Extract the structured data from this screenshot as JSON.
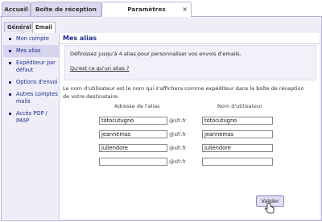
{
  "tabs": [
    {
      "label": "Accueil"
    },
    {
      "label": "Boîte de réception"
    },
    {
      "label": "Paramètres",
      "close": "×"
    }
  ],
  "subtabs": [
    {
      "label": "Général"
    },
    {
      "label": "Email"
    }
  ],
  "sidebar": {
    "items": [
      {
        "label": "Mon compte"
      },
      {
        "label": "Mes alias"
      },
      {
        "label": "Expéditeur par défaut"
      },
      {
        "label": "Options d'envoi"
      },
      {
        "label": "Autres comptes mails"
      },
      {
        "label": "Accès POP / IMAP"
      }
    ]
  },
  "main": {
    "heading": "Mes alias",
    "info_text": "Définissez jusqu'à 4 alias pour personnaliser vos envois d'emails.",
    "info_link": "Qu'est ce qu'un alias ?",
    "description": "Le nom d'utilisateur est le nom qui s'affichera comme expéditeur dans la boîte de réception de votre destinataire.",
    "col_alias": "Adresse de l'alias",
    "col_user": "Nom d'utilisateur",
    "domain": "@sfr.fr",
    "rows": [
      {
        "alias": "totocutugno",
        "user": "totocutugno"
      },
      {
        "alias": "jeannemas",
        "user": "jeannemas"
      },
      {
        "alias": "juliendore",
        "user": "juliendore"
      },
      {
        "alias": "",
        "user": ""
      }
    ],
    "submit": "Valider"
  }
}
